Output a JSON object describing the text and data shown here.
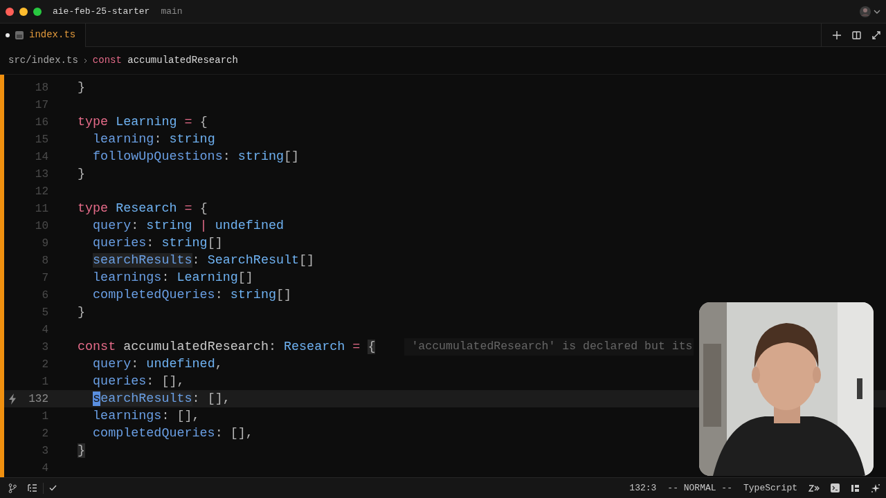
{
  "window": {
    "project": "aie-feb-25-starter",
    "branch": "main"
  },
  "tabs": [
    {
      "label": "index.ts",
      "modified": true,
      "selected": true
    }
  ],
  "breadcrumb": {
    "path": "src/index.ts",
    "symbol_kind": "const",
    "symbol": "accumulatedResearch"
  },
  "editor": {
    "lines": [
      {
        "number": "18",
        "current": false,
        "tokens": [
          {
            "text": "}",
            "kind": "punct"
          }
        ]
      },
      {
        "number": "17",
        "current": false
      },
      {
        "number": "16",
        "current": false,
        "tokens": [
          {
            "text": "type",
            "kind": "keyword"
          },
          {
            "text": " Learning",
            "kind": "type"
          },
          {
            "text": " = ",
            "kind": "keyword"
          },
          {
            "text": "{",
            "kind": "punct"
          }
        ]
      },
      {
        "number": "15",
        "current": false,
        "tokens": [
          {
            "text": "  learning",
            "kind": "property"
          },
          {
            "text": ": ",
            "kind": "punct"
          },
          {
            "text": "string",
            "kind": "type"
          }
        ]
      },
      {
        "number": "14",
        "current": false,
        "tokens": [
          {
            "text": "  followUpQuestions",
            "kind": "property"
          },
          {
            "text": ": ",
            "kind": "punct"
          },
          {
            "text": "string",
            "kind": "type"
          },
          {
            "text": "[]",
            "kind": "punct"
          }
        ]
      },
      {
        "number": "13",
        "current": false,
        "tokens": [
          {
            "text": "}",
            "kind": "punct"
          }
        ]
      },
      {
        "number": "12",
        "current": false
      },
      {
        "number": "11",
        "current": false,
        "tokens": [
          {
            "text": "type",
            "kind": "keyword"
          },
          {
            "text": " Research",
            "kind": "type"
          },
          {
            "text": " = ",
            "kind": "keyword"
          },
          {
            "text": "{",
            "kind": "punct"
          }
        ]
      },
      {
        "number": "10",
        "current": false,
        "tokens": [
          {
            "text": "  query",
            "kind": "property"
          },
          {
            "text": ": ",
            "kind": "punct"
          },
          {
            "text": "string",
            "kind": "type"
          },
          {
            "text": " | ",
            "kind": "keyword"
          },
          {
            "text": "undefined",
            "kind": "type"
          }
        ]
      },
      {
        "number": "9",
        "current": false,
        "tokens": [
          {
            "text": "  queries",
            "kind": "property"
          },
          {
            "text": ": ",
            "kind": "punct"
          },
          {
            "text": "string",
            "kind": "type"
          },
          {
            "text": "[]",
            "kind": "punct"
          }
        ]
      },
      {
        "number": "8",
        "current": false,
        "tokens": [
          {
            "text": "  searchResults",
            "kind": "match"
          },
          {
            "text": ": ",
            "kind": "punct"
          },
          {
            "text": "SearchResult",
            "kind": "type"
          },
          {
            "text": "[]",
            "kind": "punct"
          }
        ]
      },
      {
        "number": "7",
        "current": false,
        "tokens": [
          {
            "text": "  learnings",
            "kind": "property"
          },
          {
            "text": ": ",
            "kind": "punct"
          },
          {
            "text": "Learning",
            "kind": "type"
          },
          {
            "text": "[]",
            "kind": "punct"
          }
        ]
      },
      {
        "number": "6",
        "current": false,
        "tokens": [
          {
            "text": "  completedQueries",
            "kind": "property"
          },
          {
            "text": ": ",
            "kind": "punct"
          },
          {
            "text": "string",
            "kind": "type"
          },
          {
            "text": "[]",
            "kind": "punct"
          }
        ]
      },
      {
        "number": "5",
        "current": false,
        "tokens": [
          {
            "text": "}",
            "kind": "punct"
          }
        ]
      },
      {
        "number": "4",
        "current": false
      },
      {
        "number": "3",
        "current": false,
        "tokens": [
          {
            "text": "const",
            "kind": "keyword"
          },
          {
            "text": " accumulatedResearch",
            "kind": "name"
          },
          {
            "text": ": ",
            "kind": "punct"
          },
          {
            "text": "Research",
            "kind": "type"
          },
          {
            "text": " = ",
            "kind": "keyword"
          },
          {
            "text": "{",
            "kind": "bracket"
          }
        ],
        "hint": "'accumulatedResearch' is declared but its"
      },
      {
        "number": "2",
        "current": false,
        "tokens": [
          {
            "text": "  query",
            "kind": "property"
          },
          {
            "text": ": ",
            "kind": "punct"
          },
          {
            "text": "undefined",
            "kind": "type"
          },
          {
            "text": ",",
            "kind": "punct"
          }
        ]
      },
      {
        "number": "1",
        "current": false,
        "tokens": [
          {
            "text": "  queries",
            "kind": "property"
          },
          {
            "text": ": [],",
            "kind": "punct"
          }
        ]
      },
      {
        "number": "132",
        "current": true,
        "tokens": [
          {
            "text": "  s",
            "kind": "cursor"
          },
          {
            "text": "earchResults",
            "kind": "match"
          },
          {
            "text": ": [],",
            "kind": "punct"
          }
        ]
      },
      {
        "number": "1",
        "current": false,
        "tokens": [
          {
            "text": "  learnings",
            "kind": "property"
          },
          {
            "text": ": [],",
            "kind": "punct"
          }
        ]
      },
      {
        "number": "2",
        "current": false,
        "tokens": [
          {
            "text": "  completedQueries",
            "kind": "property"
          },
          {
            "text": ": [],",
            "kind": "punct"
          }
        ]
      },
      {
        "number": "3",
        "current": false,
        "tokens": [
          {
            "text": "}",
            "kind": "bracket"
          }
        ]
      },
      {
        "number": "4",
        "current": false
      }
    ]
  },
  "status_bar": {
    "position": "132:3",
    "mode": "-- NORMAL --",
    "language": "TypeScript"
  }
}
